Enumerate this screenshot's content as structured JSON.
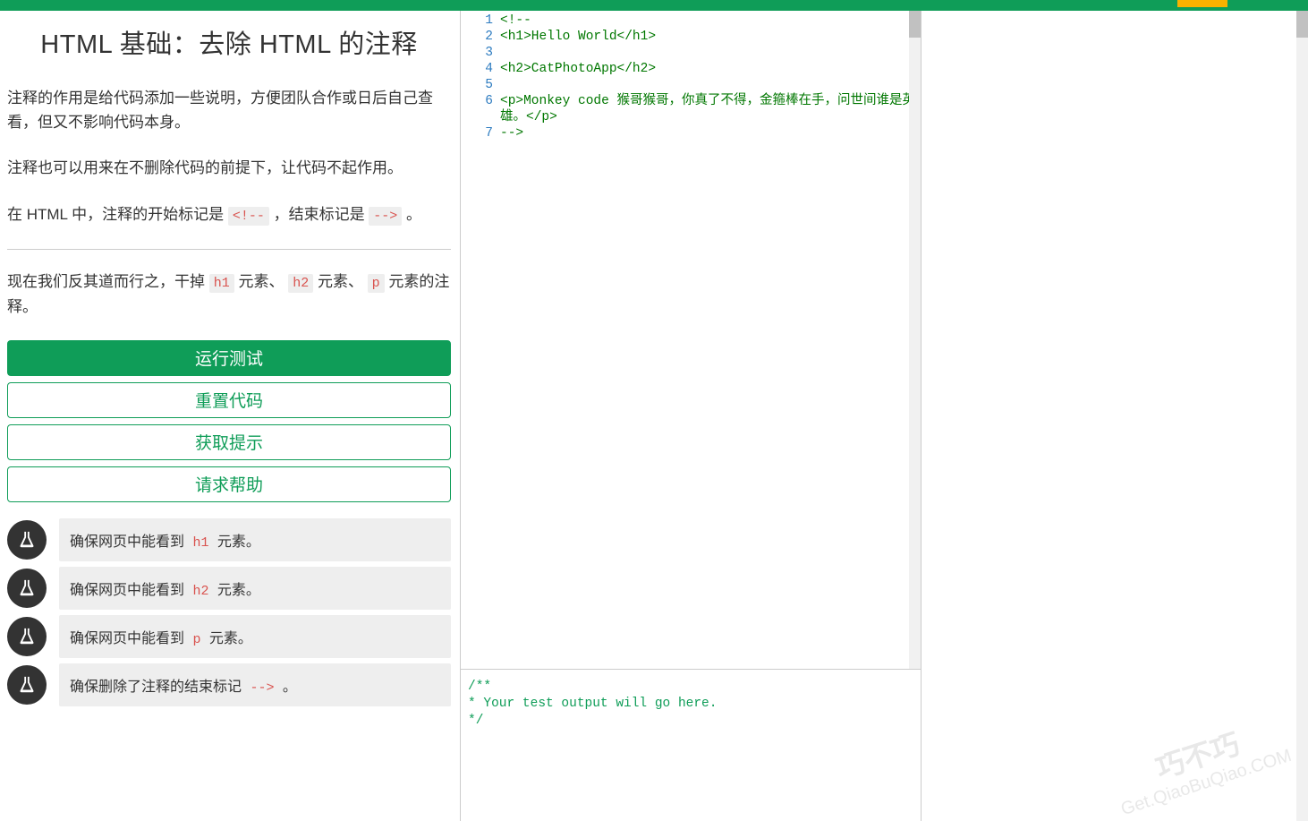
{
  "lesson": {
    "title": "HTML 基础：去除 HTML 的注释",
    "para1": "注释的作用是给代码添加一些说明，方便团队合作或日后自己查看，但又不影响代码本身。",
    "para2": "注释也可以用来在不删除代码的前提下，让代码不起作用。",
    "para3_a": "在 HTML 中，注释的开始标记是 ",
    "para3_code1": "<!--",
    "para3_b": " ，结束标记是 ",
    "para3_code2": "-->",
    "para3_c": " 。",
    "task_a": "现在我们反其道而行之，干掉 ",
    "task_code1": "h1",
    "task_b": " 元素、 ",
    "task_code2": "h2",
    "task_c": " 元素、 ",
    "task_code3": "p",
    "task_d": " 元素的注释。"
  },
  "buttons": {
    "run": "运行测试",
    "reset": "重置代码",
    "hint": "获取提示",
    "help": "请求帮助"
  },
  "tests": [
    {
      "pre": "确保网页中能看到 ",
      "code": "h1",
      "post": " 元素。"
    },
    {
      "pre": "确保网页中能看到 ",
      "code": "h2",
      "post": " 元素。"
    },
    {
      "pre": "确保网页中能看到 ",
      "code": "p",
      "post": " 元素。"
    },
    {
      "pre": "确保删除了注释的结束标记 ",
      "code": "-->",
      "post": " 。"
    }
  ],
  "editor": {
    "lines": [
      "<!--",
      "<h1>Hello World</h1>",
      "",
      "<h2>CatPhotoApp</h2>",
      "",
      "<p>Monkey code 猴哥猴哥，你真了不得，金箍棒在手，问世间谁是英雄。</p>",
      "-->"
    ]
  },
  "output": {
    "text": "/**\n* Your test output will go here.\n*/"
  },
  "watermark": {
    "line1": "巧不巧",
    "line2": "Get.QiaoBuQiao.COM"
  }
}
